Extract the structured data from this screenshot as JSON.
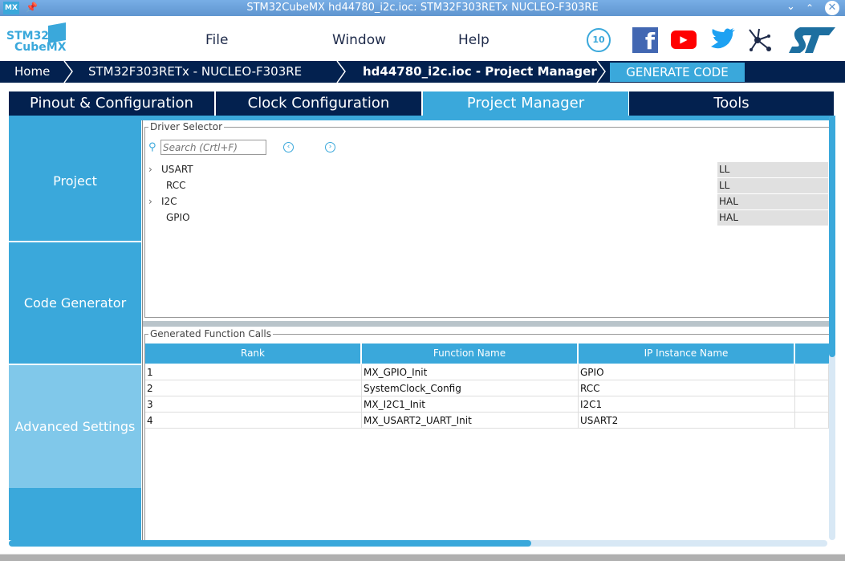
{
  "window": {
    "title": "STM32CubeMX hd44780_i2c.ioc: STM32F303RETx NUCLEO-F303RE",
    "app_badge": "MX"
  },
  "logo": {
    "line1": "STM32",
    "line2": "CubeMX"
  },
  "menu": {
    "file": "File",
    "window": "Window",
    "help": "Help"
  },
  "breadcrumb": {
    "home": "Home",
    "device": "STM32F303RETx  -  NUCLEO-F303RE",
    "project": "hd44780_i2c.ioc - Project Manager",
    "generate": "GENERATE CODE"
  },
  "tabs": [
    "Pinout & Configuration",
    "Clock Configuration",
    "Project Manager",
    "Tools"
  ],
  "sidebar": [
    "Project",
    "Code Generator",
    "Advanced Settings"
  ],
  "driver_selector": {
    "title": "Driver Selector",
    "search_placeholder": "Search (Crtl+F)",
    "rows": [
      {
        "name": "USART",
        "value": "LL",
        "expandable": true
      },
      {
        "name": "RCC",
        "value": "LL",
        "expandable": false
      },
      {
        "name": "I2C",
        "value": "HAL",
        "expandable": true
      },
      {
        "name": "GPIO",
        "value": "HAL",
        "expandable": false
      }
    ]
  },
  "function_calls": {
    "title": "Generated Function Calls",
    "headers": [
      "Rank",
      "Function Name",
      "IP Instance Name"
    ],
    "rows": [
      [
        "1",
        "MX_GPIO_Init",
        "GPIO"
      ],
      [
        "2",
        "SystemClock_Config",
        "RCC"
      ],
      [
        "3",
        "MX_I2C1_Init",
        "I2C1"
      ],
      [
        "4",
        "MX_USART2_UART_Init",
        "USART2"
      ]
    ]
  },
  "badge10": "10"
}
